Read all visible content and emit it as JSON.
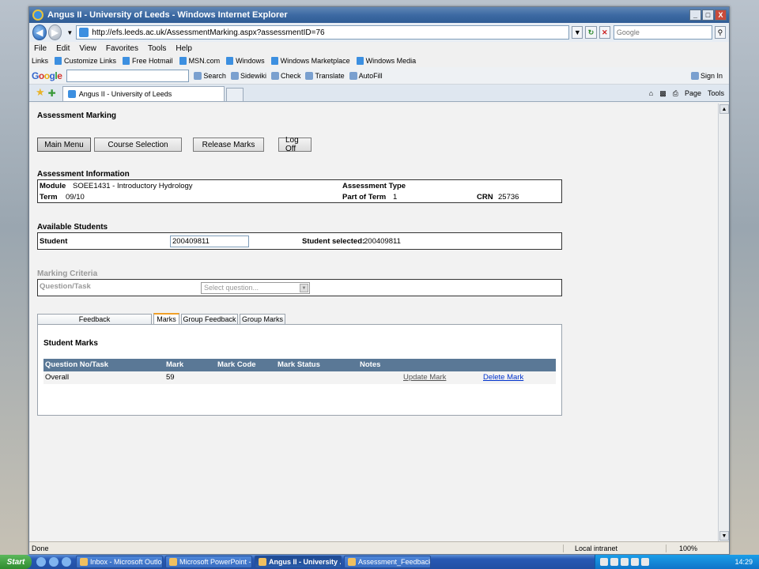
{
  "window": {
    "title": "Angus II - University of Leeds - Windows Internet Explorer",
    "controls": [
      "_",
      "□",
      "X"
    ]
  },
  "address": {
    "url": "http://efs.leeds.ac.uk/AssessmentMarking.aspx?assessmentID=76",
    "search_placeholder": "Google"
  },
  "menu": [
    "File",
    "Edit",
    "View",
    "Favorites",
    "Tools",
    "Help"
  ],
  "links": {
    "label": "Links",
    "items": [
      "Customize Links",
      "Free Hotmail",
      "MSN.com",
      "Windows",
      "Windows Marketplace",
      "Windows Media"
    ]
  },
  "google_toolbar": {
    "logo": "Google",
    "items": [
      "Search",
      "Sidewiki",
      "Check",
      "Translate",
      "AutoFill"
    ],
    "sign_in": "Sign In"
  },
  "tab": {
    "label": "Angus II - University of Leeds",
    "tools": [
      "Page",
      "Tools"
    ]
  },
  "page": {
    "title": "Assessment Marking",
    "buttons": [
      "Main Menu",
      "Course Selection",
      "Release Marks",
      "Log Off"
    ],
    "assessment_info": {
      "heading": "Assessment Information",
      "module_label": "Module",
      "module_value": "SOEE1431 - Introductory Hydrology",
      "type_label": "Assessment Type",
      "term_label": "Term",
      "term_value": "09/10",
      "part_label": "Part of Term",
      "part_value": "1",
      "crn_label": "CRN",
      "crn_value": "25736"
    },
    "students": {
      "heading": "Available Students",
      "student_label": "Student",
      "student_value": "200409811",
      "selected_label": "Student selected:",
      "selected_value": "200409811"
    },
    "criteria": {
      "heading": "Marking Criteria",
      "question_label": "Question/Task",
      "select_placeholder": "Select question..."
    },
    "tabs": [
      "Feedback",
      "Marks",
      "Group Feedback",
      "Group Marks"
    ],
    "marks_panel": {
      "heading": "Student Marks",
      "columns": [
        "Question No/Task",
        "Mark",
        "Mark Code",
        "Mark Status",
        "Notes"
      ],
      "rows": [
        {
          "task": "Overall",
          "mark": "59",
          "update": "Update Mark",
          "delete": "Delete Mark"
        }
      ]
    }
  },
  "status": {
    "text": "Done",
    "zone": "Local intranet",
    "zoom": "100%"
  },
  "taskbar": {
    "start": "Start",
    "items": [
      "Inbox - Microsoft Outlook",
      "Microsoft PowerPoint - [...",
      "Angus II - University ...",
      "Assessment_Feedback_..."
    ],
    "clock": "14:29"
  }
}
